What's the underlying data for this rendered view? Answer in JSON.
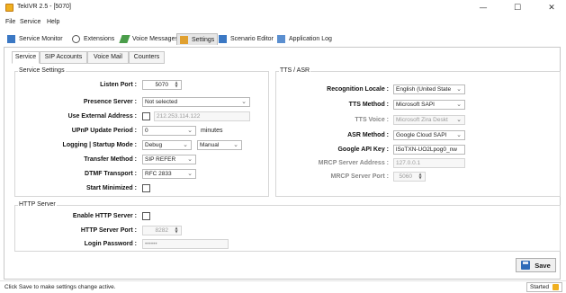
{
  "window": {
    "title": "TekIVR 2.5 - [5070]",
    "minimize": "—",
    "maximize": "☐",
    "close": "✕"
  },
  "menu": {
    "file": "File",
    "service": "Service",
    "help": "Help"
  },
  "toolbar": {
    "service_monitor": "Service Monitor",
    "extensions": "Extensions",
    "voice_messages": "Voice Messages",
    "settings": "Settings",
    "scenario_editor": "Scenario Editor",
    "application_log": "Application Log"
  },
  "subtabs": {
    "service": "Service",
    "sip_accounts": "SIP Accounts",
    "voice_mail": "Voice Mail",
    "counters": "Counters"
  },
  "service_settings": {
    "title": "Service Settings",
    "listen_port": {
      "label": "Listen Port :",
      "value": "5070"
    },
    "presence_server": {
      "label": "Presence Server :",
      "value": "Not selected"
    },
    "use_external_address": {
      "label": "Use External Address :",
      "value": "212.253.114.122",
      "checked": false
    },
    "upnp_update_period": {
      "label": "UPnP Update Period :",
      "value": "0",
      "unit": "minutes"
    },
    "logging_startup_mode": {
      "label": "Logging | Startup Mode :",
      "value": "Debug",
      "value2": "Manual"
    },
    "transfer_method": {
      "label": "Transfer Method :",
      "value": "SIP REFER"
    },
    "dtmf_transport": {
      "label": "DTMF Transport :",
      "value": "RFC 2833"
    },
    "start_minimized": {
      "label": "Start Minimized :",
      "checked": false
    }
  },
  "tts_asr": {
    "title": "TTS / ASR",
    "recognition_locale": {
      "label": "Recognition Locale :",
      "value": "English (United State"
    },
    "tts_method": {
      "label": "TTS Method :",
      "value": "Microsoft SAPI"
    },
    "tts_voice": {
      "label": "TTS Voice :",
      "value": "Microsoft Zira Deskt"
    },
    "asr_method": {
      "label": "ASR Method :",
      "value": "Google Cloud SAPI"
    },
    "google_api_key": {
      "label": "Google API Key :",
      "value": "lSoTXN-UO2Lpog0_nw"
    },
    "mrcp_server_address": {
      "label": "MRCP Server Address :",
      "value": "127.0.0.1"
    },
    "mrcp_server_port": {
      "label": "MRCP Server Port :",
      "value": "5060"
    }
  },
  "http_server": {
    "title": "HTTP Server",
    "enable_http_server": {
      "label": "Enable HTTP Server :",
      "checked": false
    },
    "http_server_port": {
      "label": "HTTP Server Port :",
      "value": "8282"
    },
    "login_password": {
      "label": "Login Password :",
      "value": "••••••"
    }
  },
  "save_button": "Save",
  "status": {
    "message": "Click Save to make settings change active.",
    "state": "Started"
  },
  "colors": {
    "accent": "#2f6bb8",
    "app_icon": "#f0b020"
  }
}
